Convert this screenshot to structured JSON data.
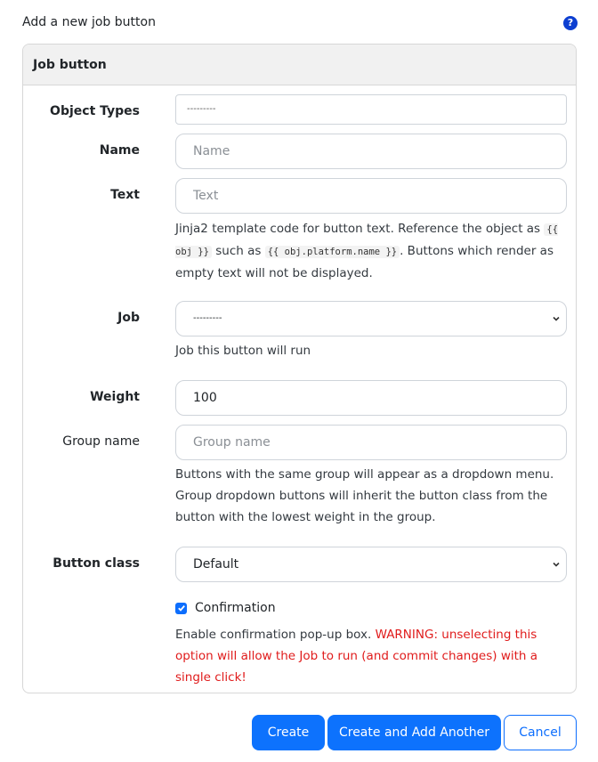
{
  "header": {
    "title": "Add a new job button",
    "help_icon": "question-circle-icon"
  },
  "panel": {
    "heading": "Job button",
    "fields": {
      "object_types": {
        "label": "Object Types",
        "value": "---------"
      },
      "name": {
        "label": "Name",
        "placeholder": "Name"
      },
      "text": {
        "label": "Text",
        "placeholder": "Text",
        "help_prefix": "Jinja2 template code for button text. Reference the object as ",
        "help_code_1": "{{ obj }}",
        "help_middle": " such as ",
        "help_code_2": "{{ obj.platform.name }}",
        "help_suffix": ". Buttons which render as empty text will not be displayed."
      },
      "job": {
        "label": "Job",
        "value": "---------",
        "help": "Job this button will run"
      },
      "weight": {
        "label": "Weight",
        "value": "100"
      },
      "group_name": {
        "label": "Group name",
        "placeholder": "Group name",
        "help": "Buttons with the same group will appear as a dropdown menu. Group dropdown buttons will inherit the button class from the button with the lowest weight in the group."
      },
      "button_class": {
        "label": "Button class",
        "value": "Default"
      },
      "confirmation": {
        "label": "Confirmation",
        "checked": true,
        "help": "Enable confirmation pop-up box. ",
        "warning": "WARNING: unselecting this option will allow the Job to run (and commit changes) with a single click!"
      }
    }
  },
  "actions": {
    "create": "Create",
    "create_and_add": "Create and Add Another",
    "cancel": "Cancel"
  },
  "colors": {
    "primary": "#0d72fd",
    "warning": "#e01b1b",
    "help_icon": "#0d3fd1"
  }
}
